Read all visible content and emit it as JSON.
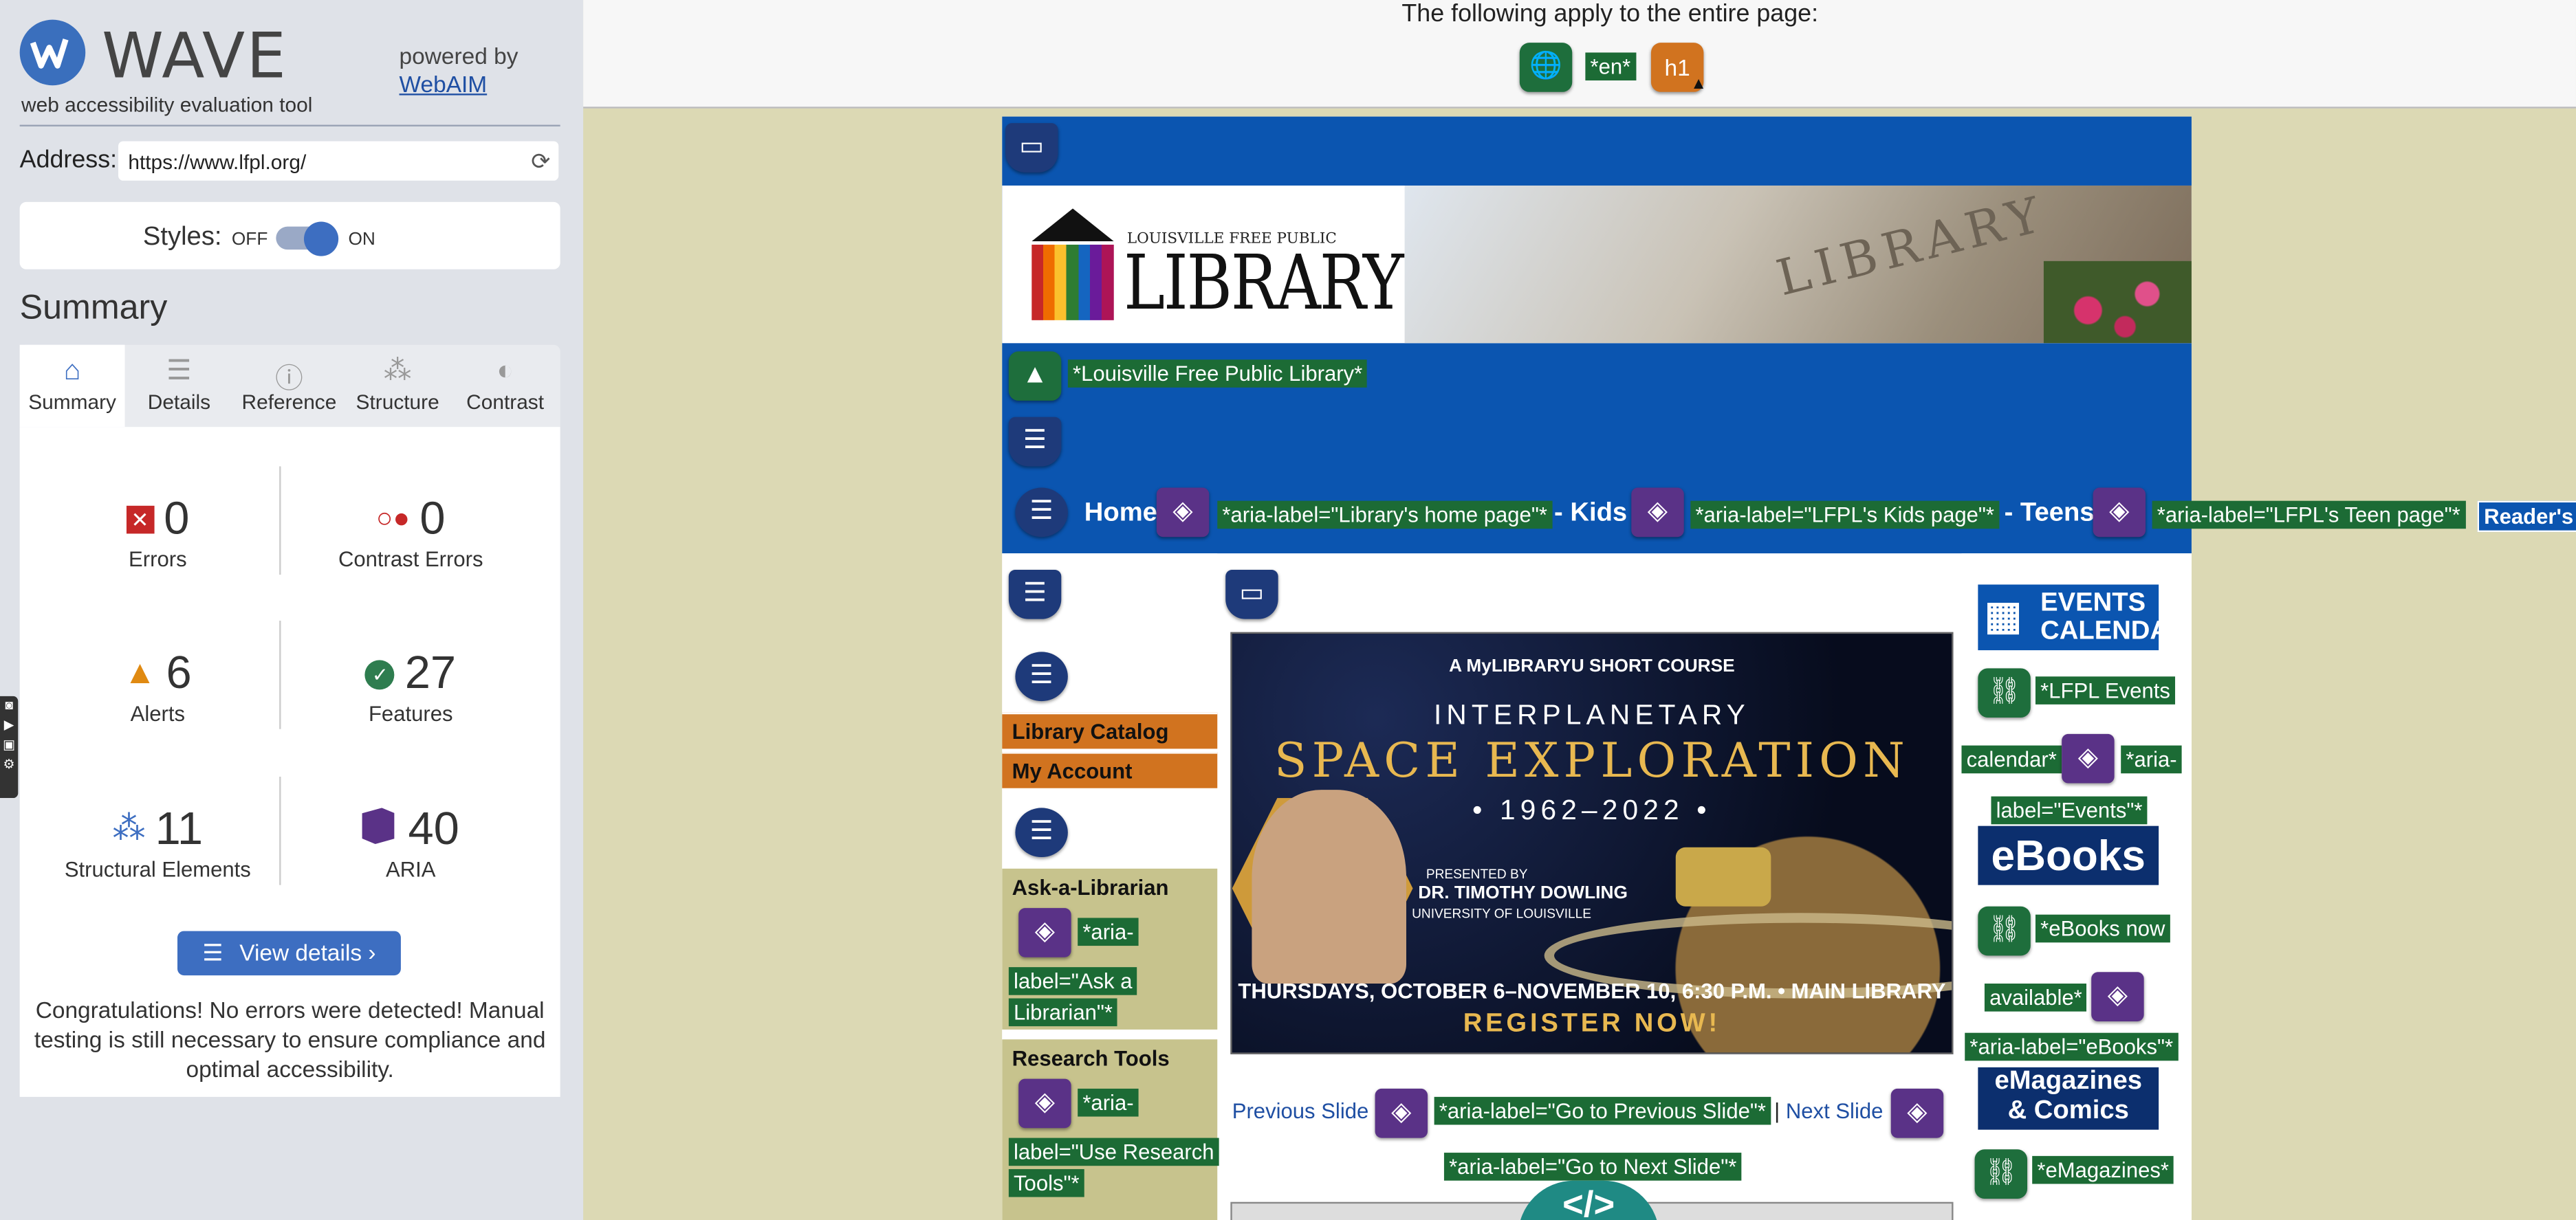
{
  "sidebar": {
    "logo_text": "WAVE",
    "tagline": "web accessibility evaluation tool",
    "powered_by": "powered by",
    "webaim_link": "WebAIM",
    "address_label": "Address:",
    "address_value": "https://www.lfpl.org/",
    "styles_label": "Styles:",
    "styles_off": "OFF",
    "styles_on": "ON",
    "section_title": "Summary",
    "tabs": [
      {
        "label": "Summary",
        "icon": "home-icon",
        "active": true
      },
      {
        "label": "Details",
        "icon": "list-icon",
        "active": false
      },
      {
        "label": "Reference",
        "icon": "info-icon",
        "active": false
      },
      {
        "label": "Structure",
        "icon": "sitemap-icon",
        "active": false
      },
      {
        "label": "Contrast",
        "icon": "contrast-icon",
        "active": false
      }
    ],
    "stats": {
      "errors": {
        "value": "0",
        "label": "Errors"
      },
      "contrast_errors": {
        "value": "0",
        "label": "Contrast Errors"
      },
      "alerts": {
        "value": "6",
        "label": "Alerts"
      },
      "features": {
        "value": "27",
        "label": "Features"
      },
      "structural": {
        "value": "11",
        "label": "Structural Elements"
      },
      "aria": {
        "value": "40",
        "label": "ARIA"
      }
    },
    "view_details": "View details ›",
    "congrats": "Congratulations! No errors were detected! Manual testing is still necessary to ensure compliance and optimal accessibility."
  },
  "topbar": {
    "apply_text": "The following apply to the entire page:",
    "lang_label": "*en*",
    "h1_icon": "h1"
  },
  "page": {
    "logo_small": "LOUISVILLE FREE PUBLIC",
    "logo_big": "LIBRARY",
    "banner_word": "LIBRARY",
    "alt_logo": "*Louisville Free Public Library*",
    "nav": {
      "home": "Home",
      "home_aria": "*aria-label=\"Library's home page\"*",
      "kids": "- Kids",
      "kids_aria": "*aria-label=\"LFPL's Kids page\"*",
      "teens": "- Teens",
      "teens_aria": "*aria-label=\"LFPL's Teen page\"*",
      "readers": "Reader's"
    },
    "left": {
      "catalog": "Library Catalog",
      "account": "My Account",
      "ask_title": "Ask-a-Librarian",
      "ask_aria_1": "*aria-",
      "ask_aria_2": "label=\"Ask a",
      "ask_aria_3": "Librarian\"*",
      "research_title": "Research Tools",
      "research_aria_1": "*aria-",
      "research_aria_2": "label=\"Use Research",
      "research_aria_3": "Tools\"*"
    },
    "slide": {
      "line1": "A MyLIBRARYU SHORT COURSE",
      "line2": "INTERPLANETARY",
      "line3": "SPACE EXPLORATION",
      "line4": "• 1962–2022 •",
      "presenter1": "PRESENTED BY",
      "presenter2": "DR. TIMOTHY DOWLING",
      "presenter3": "UNIVERSITY OF LOUISVILLE",
      "dates": "THURSDAYS, OCTOBER 6–NOVEMBER 10, 6:30 P.M. • MAIN LIBRARY",
      "register": "REGISTER NOW!"
    },
    "slide_nav": {
      "prev": "Previous Slide",
      "prev_aria": "*aria-label=\"Go to Previous Slide\"*",
      "sep": "|",
      "next": "Next Slide",
      "next_aria": "*aria-label=\"Go to Next Slide\"*"
    },
    "right": {
      "events_1": "EVENTS",
      "events_2": "CALENDAR",
      "events_link_1": "*LFPL Events",
      "events_link_2": "calendar*",
      "events_aria_1": "*aria-",
      "events_aria_2": "label=\"Events\"*",
      "ebooks": "eBooks",
      "ebooks_link_1": "*eBooks now",
      "ebooks_link_2": "available*",
      "ebooks_aria": "*aria-label=\"eBooks\"*",
      "emag_1": "eMagazines",
      "emag_2": "& Comics",
      "emag_link": "*eMagazines*"
    },
    "code_toggle": "</>"
  }
}
